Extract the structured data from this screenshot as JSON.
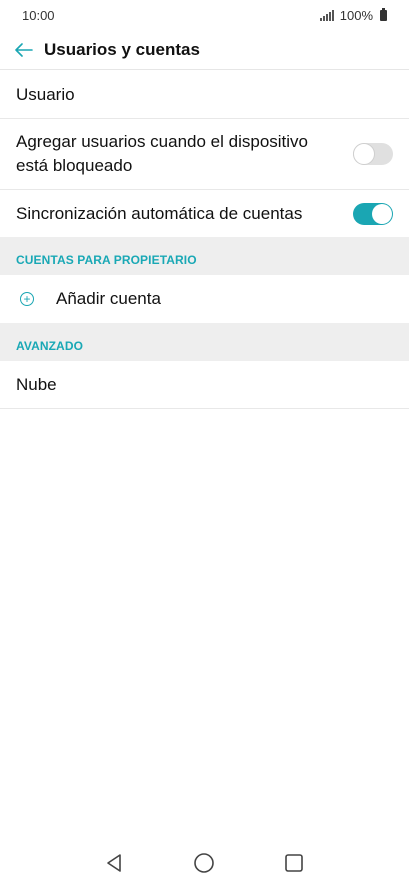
{
  "status_bar": {
    "time": "10:00",
    "battery": "100%"
  },
  "header": {
    "title": "Usuarios y cuentas"
  },
  "items": {
    "usuario": "Usuario",
    "agregar": "Agregar usuarios cuando el dispositivo está bloqueado",
    "agregar_toggle": "off",
    "sync": "Sincronización automática de cuentas",
    "sync_toggle": "on"
  },
  "sections": {
    "owner_accounts": "CUENTAS PARA PROPIETARIO",
    "advanced": "AVANZADO"
  },
  "owner_accounts": {
    "add_label": "Añadir cuenta"
  },
  "advanced": {
    "cloud_label": "Nube"
  },
  "colors": {
    "accent": "#1aa6b3"
  }
}
